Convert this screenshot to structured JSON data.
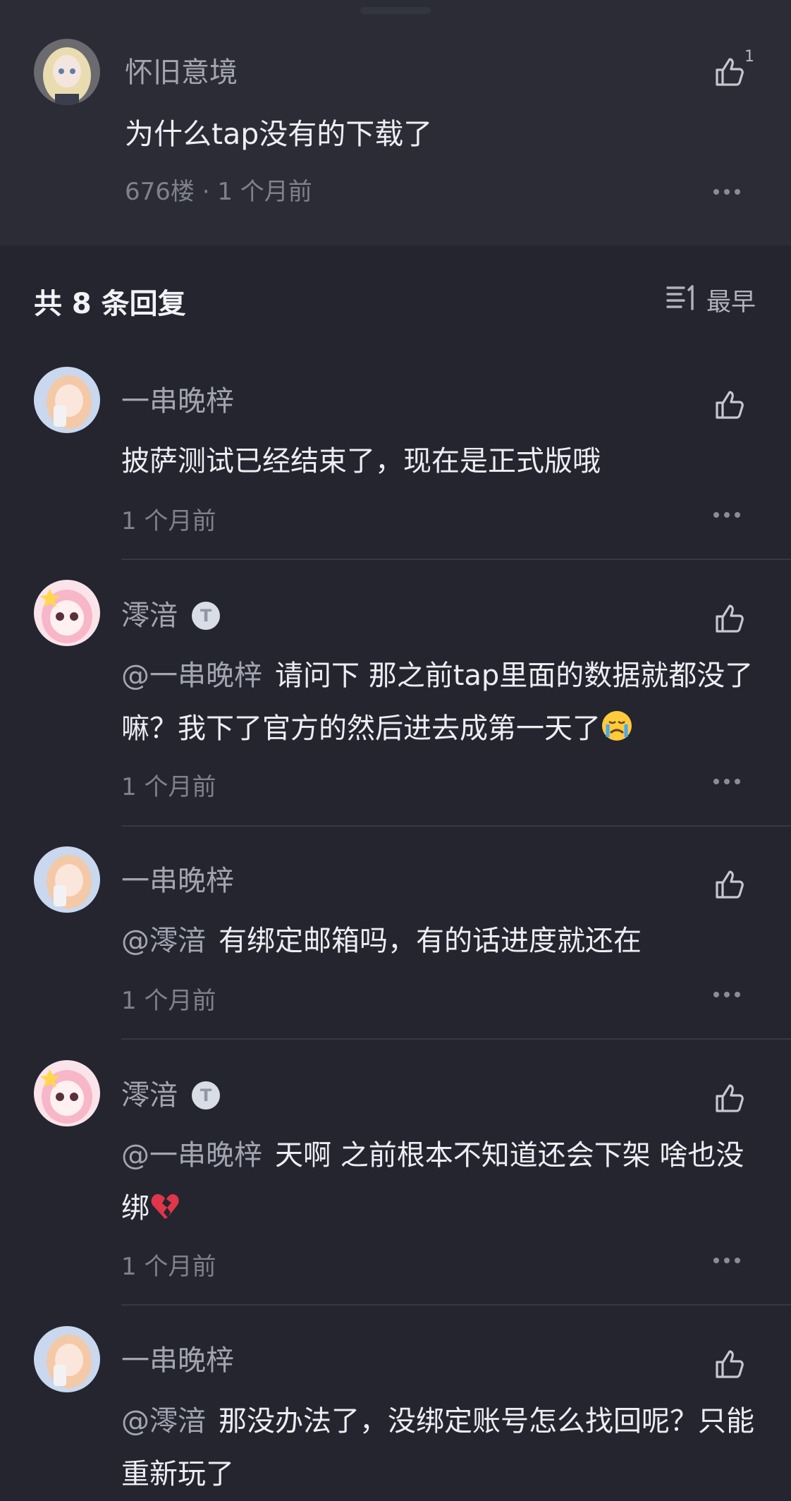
{
  "op": {
    "username": "怀旧意境",
    "text": "为什么tap没有的下载了",
    "meta": "676楼 · 1 个月前",
    "like_count": "1"
  },
  "replies_header": {
    "title": "共 8 条回复",
    "sort_label": "最早"
  },
  "replies": [
    {
      "username": "一串晚梓",
      "mention": "",
      "text": "披萨测试已经结束了，现在是正式版哦",
      "time": "1 个月前"
    },
    {
      "username": "澪湆",
      "mention": "@一串晚梓",
      "text": "请问下 那之前tap里面的数据就都没了嘛？我下了官方的然后进去成第一天了",
      "time": "1 个月前",
      "badge": "T"
    },
    {
      "username": "一串晚梓",
      "mention": "@澪湆",
      "text": "有绑定邮箱吗，有的话进度就还在",
      "time": "1 个月前"
    },
    {
      "username": "澪湆",
      "mention": "@一串晚梓",
      "text": "天啊 之前根本不知道还会下架 啥也没绑",
      "time": "1 个月前",
      "badge": "T"
    },
    {
      "username": "一串晚梓",
      "mention": "@澪湆",
      "text": "那没办法了，没绑定账号怎么找回呢？只能重新玩了",
      "time": ""
    }
  ]
}
